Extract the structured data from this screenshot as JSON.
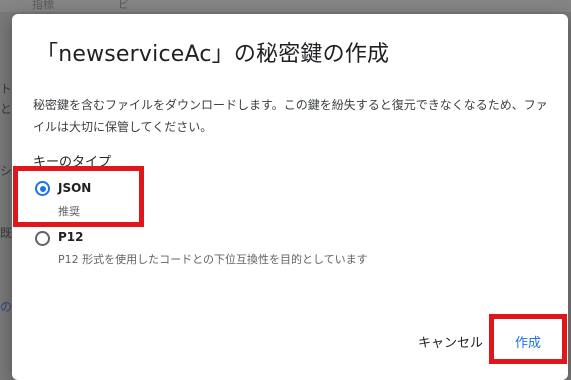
{
  "background": {
    "top_tabs": [
      "指標",
      "ビ"
    ],
    "left_fragments": [
      "ト",
      "と",
      "シ",
      "既",
      "の"
    ]
  },
  "dialog": {
    "title": "「newserviceAc」の秘密鍵の作成",
    "description": "秘密鍵を含むファイルをダウンロードします。この鍵を紛失すると復元できなくなるため、ファイルは大切に保管してください。",
    "key_type_label": "キーのタイプ",
    "options": [
      {
        "label": "JSON",
        "sublabel": "推奨",
        "selected": true
      },
      {
        "label": "P12",
        "sublabel": "P12 形式を使用したコードとの下位互換性を目的としています",
        "selected": false
      }
    ],
    "cancel_label": "キャンセル",
    "create_label": "作成"
  },
  "colors": {
    "accent": "#1a73e8",
    "highlight": "#e0161b",
    "overlay": "#7a7a7a"
  }
}
